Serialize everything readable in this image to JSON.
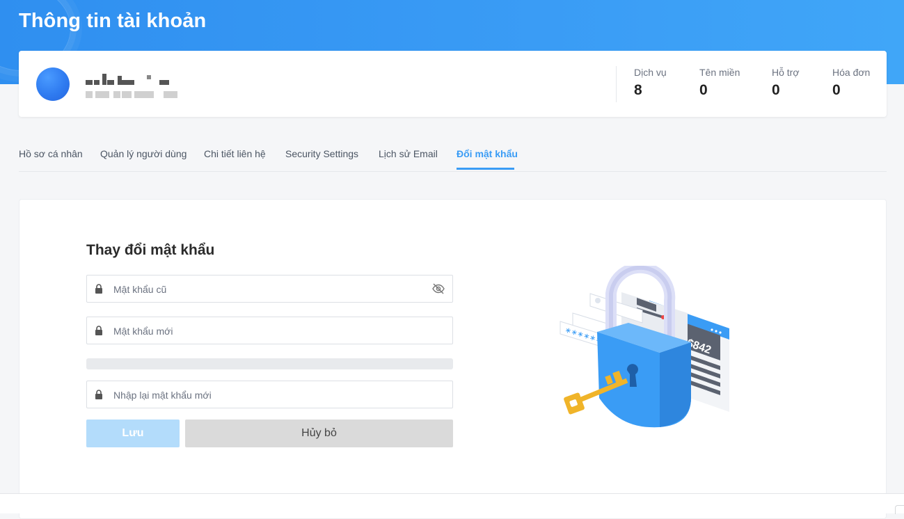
{
  "header": {
    "title": "Thông tin tài khoản"
  },
  "account": {
    "stats": [
      {
        "label": "Dịch vụ",
        "value": "8"
      },
      {
        "label": "Tên miền",
        "value": "0"
      },
      {
        "label": "Hỗ trợ",
        "value": "0"
      },
      {
        "label": "Hóa đơn",
        "value": "0"
      }
    ]
  },
  "tabs": [
    {
      "label": "Hồ sơ cá nhân",
      "active": false
    },
    {
      "label": "Quản lý người dùng",
      "active": false
    },
    {
      "label": "Chi tiết liên hệ",
      "active": false
    },
    {
      "label": "Security Settings",
      "active": false
    },
    {
      "label": "Lịch sử Email",
      "active": false
    },
    {
      "label": "Đổi mật khẩu",
      "active": true
    }
  ],
  "form": {
    "title": "Thay đổi mật khẩu",
    "old_password": {
      "value": "",
      "placeholder": "Mật khẩu cũ"
    },
    "new_password": {
      "value": "",
      "placeholder": "Mật khẩu mới"
    },
    "confirm_password": {
      "value": "",
      "placeholder": "Nhập lại mật khẩu mới"
    },
    "strength": 0,
    "save_label": "Lưu",
    "cancel_label": "Hủy bỏ"
  },
  "illustration": {
    "amount": "$842"
  },
  "colors": {
    "brand": "#3a9cf5",
    "save_disabled": "#b3dcfb",
    "cancel": "#dadada"
  }
}
